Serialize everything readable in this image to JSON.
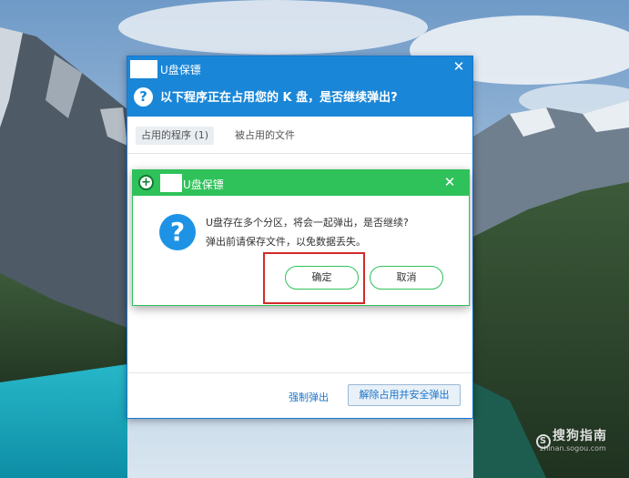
{
  "main_window": {
    "app_name": "U盘保镖",
    "close_glyph": "✕",
    "question_glyph": "?",
    "question": "以下程序正在占用您的 K 盘，是否继续弹出?",
    "tabs": [
      {
        "label": "占用的程序 (1)",
        "active": true
      },
      {
        "label": "被占用的文件",
        "active": false
      }
    ],
    "force_eject_label": "强制弹出",
    "safe_eject_label": "解除占用并安全弹出"
  },
  "dialog": {
    "app_icon_glyph": "+",
    "app_name": "U盘保镖",
    "close_glyph": "✕",
    "question_glyph": "?",
    "message_line1": "U盘存在多个分区，将会一起弹出，是否继续?",
    "message_line2": "弹出前请保存文件，以免数据丢失。",
    "ok_label": "确定",
    "cancel_label": "取消"
  },
  "watermark": {
    "brand": "搜狗指南",
    "domain": "zhinan.sogou.com"
  },
  "colors": {
    "main_header": "#1a86d7",
    "dialog_header": "#2fc25a",
    "highlight": "#d22a2a",
    "link": "#1a74c7"
  }
}
